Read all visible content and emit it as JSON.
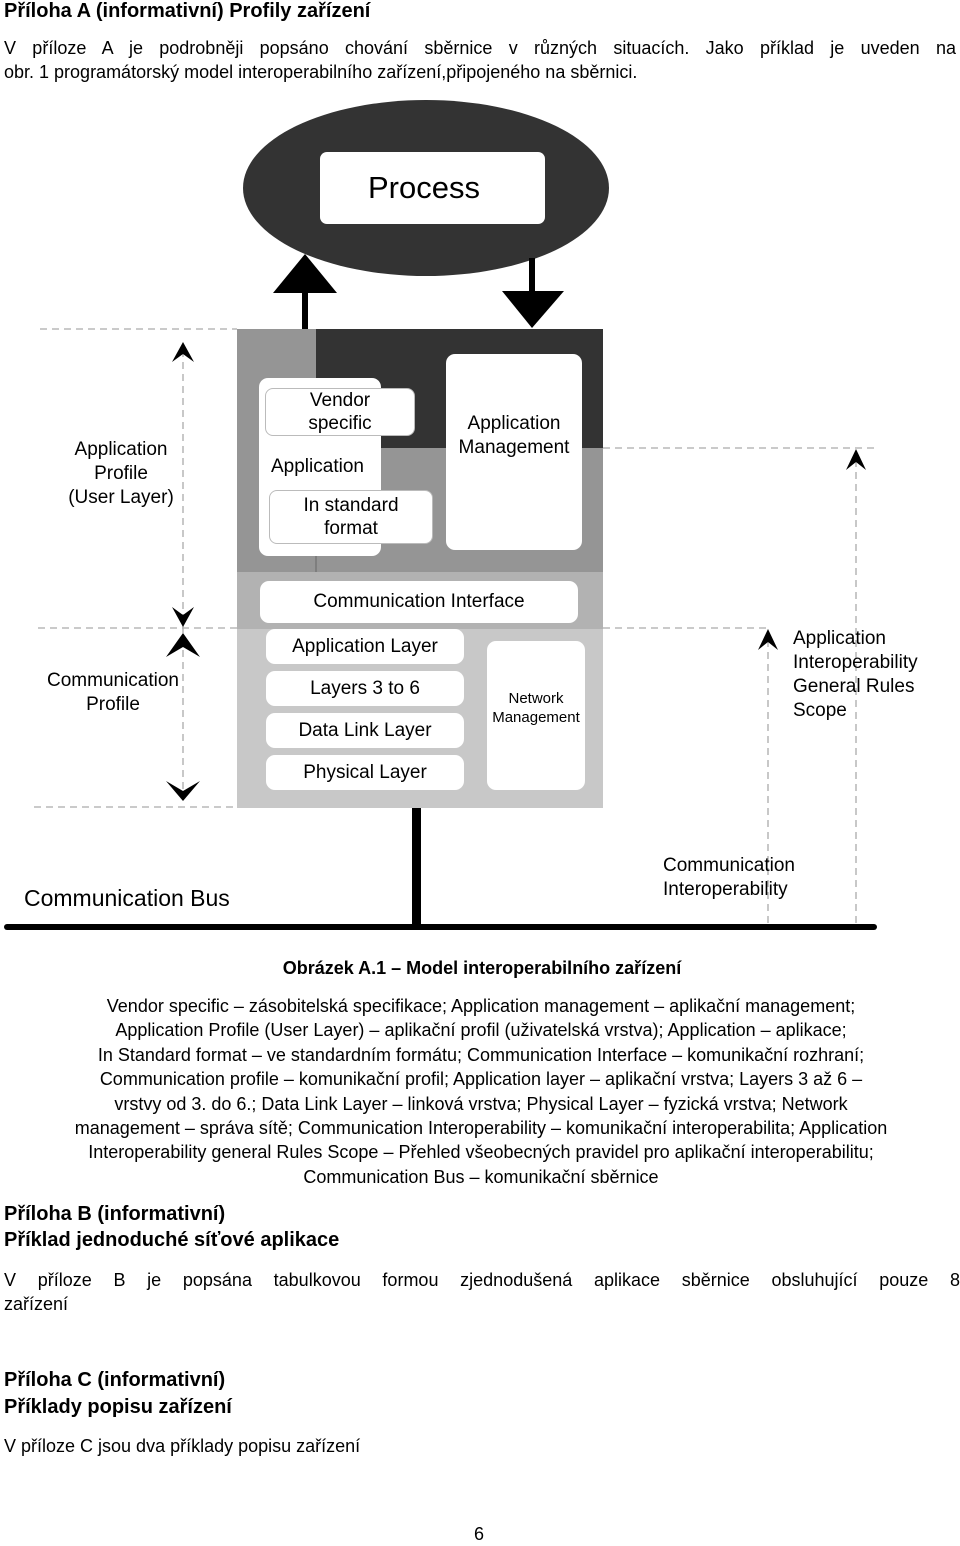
{
  "annex_a": {
    "heading": "Příloha A (informativní) Profily zařízení",
    "intro_line1": "V příloze A je podrobněji popsáno chování sběrnice v různých situacích. Jako příklad je uveden na",
    "intro_line2": "obr. 1 programátorský model interoperabilního zařízení,připojeného na sběrnici."
  },
  "diagram": {
    "process": "Process",
    "vendor_specific": [
      "Vendor",
      "specific"
    ],
    "application": "Application",
    "in_standard_format": [
      "In standard",
      "format"
    ],
    "application_management": [
      "Application",
      "Management"
    ],
    "communication_interface": "Communication Interface",
    "layers": [
      "Application Layer",
      "Layers 3 to 6",
      "Data Link Layer",
      "Physical Layer"
    ],
    "network_management": [
      "Network",
      "Management"
    ],
    "application_profile": [
      "Application",
      "Profile",
      "(User Layer)"
    ],
    "communication_profile": [
      "Communication",
      "Profile"
    ],
    "app_interop_scope": [
      "Application",
      "Interoperability",
      "General Rules",
      "Scope"
    ],
    "communication_bus": "Communication Bus",
    "communication_interoperability": [
      "Communication",
      "Interoperability"
    ],
    "colors": {
      "dark": "#333333",
      "mid_gray": "#959595",
      "light_gray": "#c8c8c8",
      "dash": "#aaaaaa"
    }
  },
  "figure_caption": "Obrázek A.1 – Model interoperabilního zařízení",
  "legend_lines": [
    "Vendor specific – zásobitelská specifikace; Application management – aplikační management;",
    "Application Profile (User Layer) – aplikační profil (uživatelská vrstva); Application – aplikace;",
    "In Standard format – ve standardním formátu; Communication Interface – komunikační rozhraní;",
    "Communication profile – komunikační profil; Application layer – aplikační vrstva; Layers 3 až 6 –",
    "vrstvy od 3. do 6.; Data Link Layer – linková vrstva; Physical Layer – fyzická vrstva; Network",
    "management – správa sítě; Communication Interoperability – komunikační interoperabilita; Application",
    "Interoperability general Rules Scope – Přehled všeobecných pravidel pro aplikační interoperabilitu;",
    "Communication Bus – komunikační sběrnice"
  ],
  "annex_b": {
    "heading1": "Příloha B (informativní)",
    "heading2": "Příklad jednoduché síťové aplikace",
    "text_line1": "V příloze B je popsána tabulkovou formou zjednodušená aplikace sběrnice obsluhující pouze 8",
    "text_line2": "zařízení"
  },
  "annex_c": {
    "heading1": "Příloha C (informativní)",
    "heading2": "Příklady popisu zařízení",
    "text": "V příloze C jsou dva příklady popisu zařízení"
  },
  "page_number": "6"
}
